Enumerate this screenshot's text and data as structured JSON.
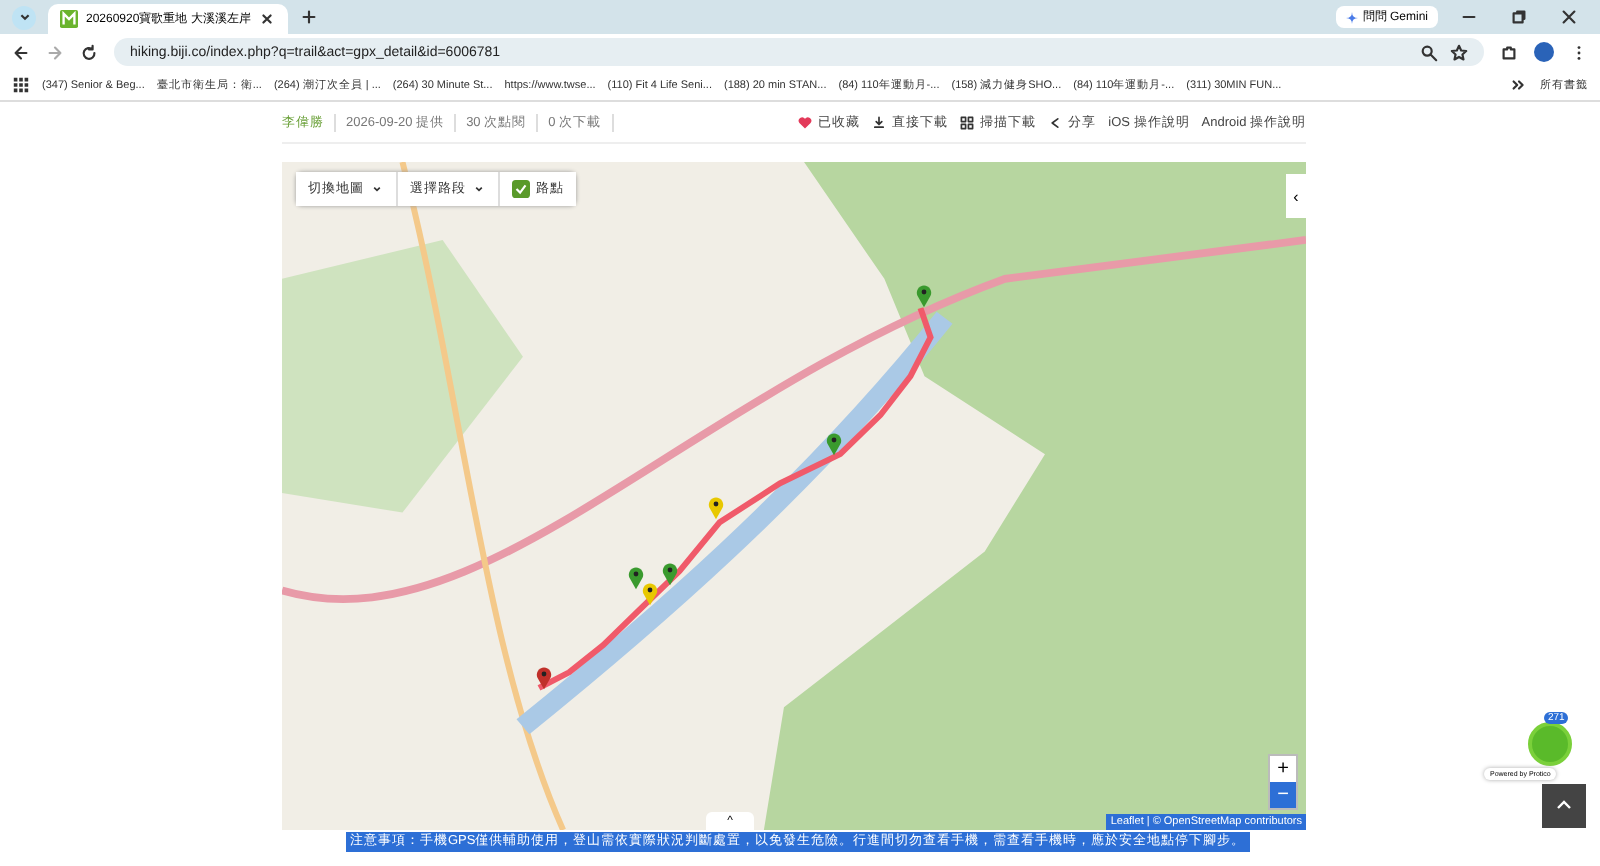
{
  "browser": {
    "tab_title": "20260920寶歌重地 大溪溪左岸",
    "gemini": "問問 Gemini",
    "url": "hiking.biji.co/index.php?q=trail&act=gpx_detail&id=6006781",
    "bookmarks": [
      "(347) Senior & Beg...",
      "臺北市衛生局：衛...",
      "(264) 潮汀次全員 | ...",
      "(264) 30 Minute St...",
      "https://www.twse...",
      "(110) Fit 4 Life Seni...",
      "(188) 20 min STAN...",
      "(84) 110年運動月-...",
      "(158) 減力健身SHO...",
      "(84) 110年運動月-...",
      "(311) 30MIN FUN..."
    ],
    "all_bookmarks": "所有書籤"
  },
  "meta": {
    "author": "李偉勝",
    "items": [
      "2026-09-20 提供",
      "30 次點閱",
      "0 次下載"
    ]
  },
  "actions": [
    {
      "kind": "favorite",
      "label": "已收藏",
      "selected": true
    },
    {
      "kind": "download",
      "label": "直接下載"
    },
    {
      "kind": "scan",
      "label": "掃描下載"
    },
    {
      "kind": "share",
      "label": "分享"
    },
    {
      "kind": "text",
      "label": "iOS 操作說明"
    },
    {
      "kind": "text",
      "label": "Android 操作說明"
    }
  ],
  "map": {
    "switch_map": "切換地圖",
    "select_segment": "選擇路段",
    "waypoints": {
      "label": "路點",
      "checked": true
    },
    "markers": [
      {
        "color": "#3a9a2e"
      },
      {
        "color": "#3a9a2e"
      },
      {
        "color": "#e8c800"
      },
      {
        "color": "#3a9a2e"
      },
      {
        "color": "#3a9a2e"
      },
      {
        "color": "#e8c800"
      },
      {
        "color": "#c0302a"
      }
    ],
    "zoom_in": "+",
    "zoom_out": "−",
    "attribution": "Leaflet | © OpenStreetMap contributors",
    "expand": "^",
    "collapse": "‹"
  },
  "notice": "注意事項：手機GPS僅供輔助使用，登山需依實際狀況判斷處置，以免發生危險。行進間切勿查看手機，需查看手機時，應於安全地點停下腳步。",
  "chat": {
    "count": "271",
    "powered": "Powered by Protico"
  }
}
